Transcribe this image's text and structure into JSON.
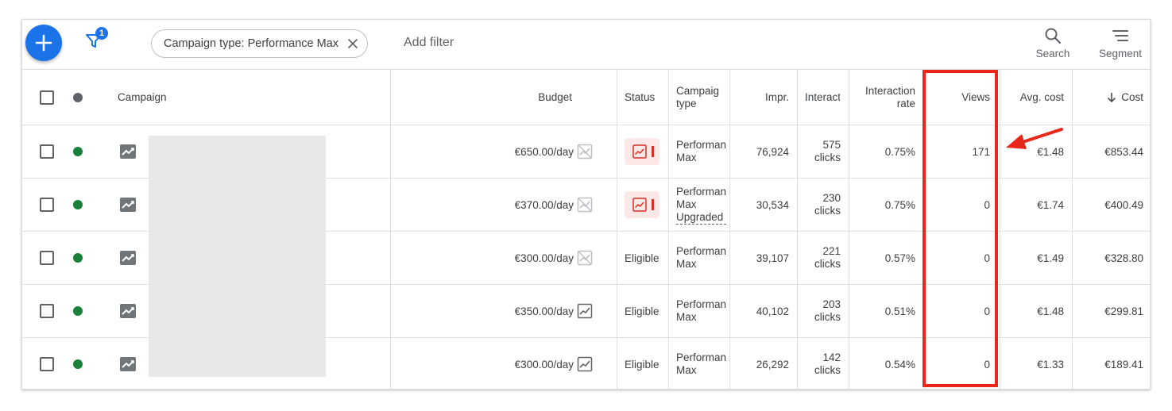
{
  "toolbar": {
    "filter_count": "1",
    "filter_chip": "Campaign type: Performance Max",
    "add_filter": "Add filter",
    "search_label": "Search",
    "segment_label": "Segment"
  },
  "header": {
    "campaign": "Campaign",
    "budget": "Budget",
    "status": "Status",
    "campaign_type": "Campaig type",
    "impr": "Impr.",
    "interactions": "Interact",
    "interaction_rate": "Interaction rate",
    "views": "Views",
    "avg_cost": "Avg. cost",
    "cost": "Cost"
  },
  "rows": [
    {
      "budget": "€650.00/day",
      "budget_icon": "chart-limited-icon",
      "status": "",
      "type_line1": "Performan",
      "type_line2": "Max",
      "type_line3": "",
      "impr": "76,924",
      "interactions": "575",
      "interactions_unit": "clicks",
      "rate": "0.75%",
      "views": "171",
      "avg_cost": "€1.48",
      "cost": "€853.44"
    },
    {
      "budget": "€370.00/day",
      "budget_icon": "chart-limited-icon",
      "status": "",
      "type_line1": "Performan",
      "type_line2": "Max",
      "type_line3": "Upgraded",
      "impr": "30,534",
      "interactions": "230",
      "interactions_unit": "clicks",
      "rate": "0.75%",
      "views": "0",
      "avg_cost": "€1.74",
      "cost": "€400.49"
    },
    {
      "budget": "€300.00/day",
      "budget_icon": "chart-limited-icon",
      "status": "Eligible",
      "type_line1": "Performan",
      "type_line2": "Max",
      "type_line3": "",
      "impr": "39,107",
      "interactions": "221",
      "interactions_unit": "clicks",
      "rate": "0.57%",
      "views": "0",
      "avg_cost": "€1.49",
      "cost": "€328.80"
    },
    {
      "budget": "€350.00/day",
      "budget_icon": "chart-icon",
      "status": "Eligible",
      "type_line1": "Performan",
      "type_line2": "Max",
      "type_line3": "",
      "impr": "40,102",
      "interactions": "203",
      "interactions_unit": "clicks",
      "rate": "0.51%",
      "views": "0",
      "avg_cost": "€1.48",
      "cost": "€299.81"
    },
    {
      "budget": "€300.00/day",
      "budget_icon": "chart-icon",
      "status": "Eligible",
      "type_line1": "Performan",
      "type_line2": "Max",
      "type_line3": "",
      "impr": "26,292",
      "interactions": "142",
      "interactions_unit": "clicks",
      "rate": "0.54%",
      "views": "0",
      "avg_cost": "€1.33",
      "cost": "€189.41"
    }
  ],
  "colors": {
    "accent": "#1a73e8",
    "enabled_dot": "#188038",
    "limited_pill": "#fce8e6",
    "annotation": "#e8261a"
  }
}
